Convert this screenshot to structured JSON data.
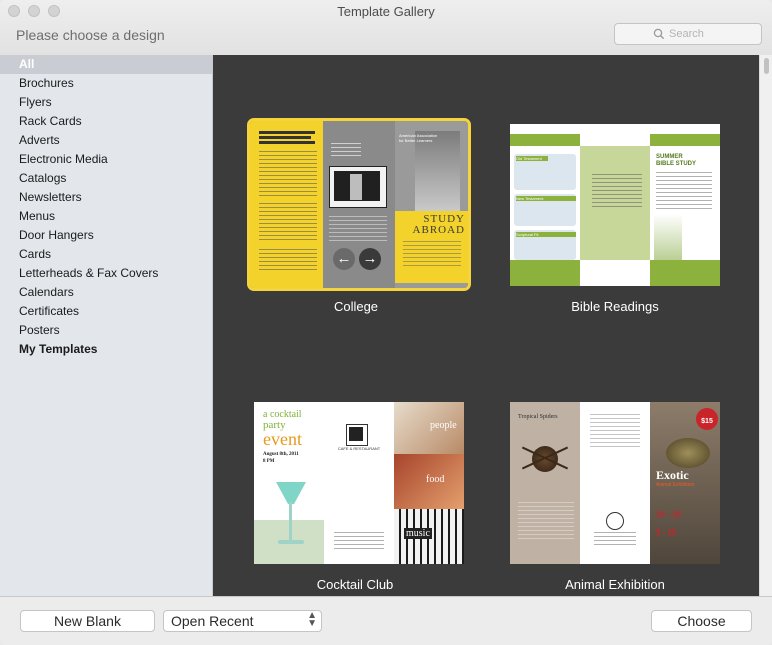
{
  "window": {
    "title": "Template Gallery",
    "subtitle": "Please choose a design"
  },
  "search": {
    "placeholder": "Search"
  },
  "sidebar": {
    "items": [
      {
        "label": "All",
        "selected": true
      },
      {
        "label": "Brochures"
      },
      {
        "label": "Flyers"
      },
      {
        "label": "Rack Cards"
      },
      {
        "label": "Adverts"
      },
      {
        "label": "Electronic Media"
      },
      {
        "label": "Catalogs"
      },
      {
        "label": "Newsletters"
      },
      {
        "label": "Menus"
      },
      {
        "label": "Door Hangers"
      },
      {
        "label": "Cards"
      },
      {
        "label": "Letterheads & Fax Covers"
      },
      {
        "label": "Calendars"
      },
      {
        "label": "Certificates"
      },
      {
        "label": "Posters"
      },
      {
        "label": "My Templates",
        "bold": true
      }
    ]
  },
  "templates": [
    {
      "name": "College",
      "selected": true,
      "texts": {
        "study": "STUDY",
        "abroad": "ABROAD",
        "org": "American Association for Better Learners"
      }
    },
    {
      "name": "Bible Readings",
      "texts": {
        "heading": "SUMMER BIBLE STUDY",
        "tab1": "Old Testament",
        "tab2": "New Testament",
        "tab3": "Scriptural Fit"
      }
    },
    {
      "name": "Cocktail Club",
      "texts": {
        "a_cocktail": "a cocktail",
        "party": "party",
        "event": "event",
        "date": "August 8th, 2011",
        "time": "8 PM",
        "people": "people",
        "food": "food",
        "music": "music",
        "cafe": "CAFE & RESTAURANT"
      }
    },
    {
      "name": "Animal Exhibition",
      "texts": {
        "tropical": "Tropical Spiders",
        "exotic": "Exotic",
        "exhibition": "Animal Exhibition",
        "dates1": "10 - 18",
        "dates2": "9 - 20",
        "price": "$15"
      }
    }
  ],
  "buttons": {
    "new_blank": "New Blank",
    "open_recent": "Open Recent",
    "choose": "Choose"
  },
  "colors": {
    "gallery_bg": "#3b3b3b",
    "selection": "#f4d43a",
    "college_yellow": "#f3d22b",
    "bible_green": "#8cb13d",
    "cocktail_green": "#7fb238",
    "cocktail_orange": "#e69a1a",
    "animal_red": "#c8242a"
  }
}
